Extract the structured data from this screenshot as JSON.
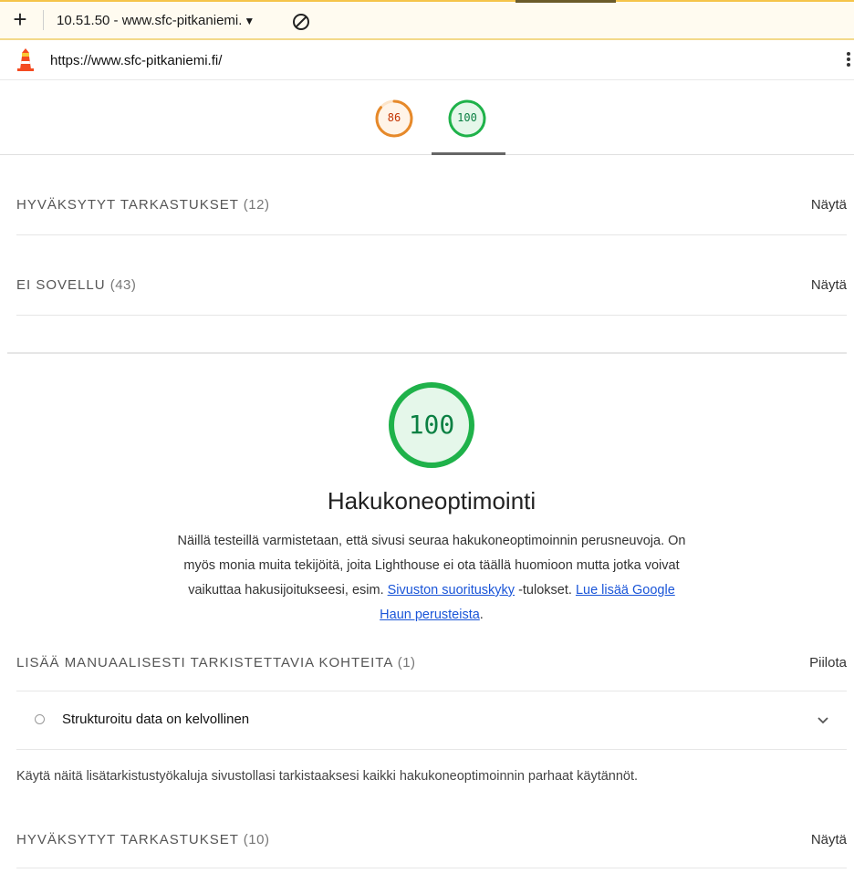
{
  "toolbar": {
    "plus_label": "+",
    "tab_title": "10.51.50 - www.sfc-pitkaniemi.",
    "dropdown_caret": "▼",
    "icons": {
      "new_tab": "plus-icon",
      "block": "block-icon"
    }
  },
  "urlbar": {
    "url": "https://www.sfc-pitkaniemi.fi/",
    "icons": {
      "logo": "lighthouse-logo-icon",
      "menu": "kebab-menu-icon"
    }
  },
  "score_tabs": [
    {
      "score": "86",
      "color": "#e6892a",
      "fill": "#fff4e8",
      "selected": false
    },
    {
      "score": "100",
      "color": "#1fb24a",
      "fill": "#e5f7ea",
      "selected": true
    }
  ],
  "groups_top": [
    {
      "title": "HYVÄKSYTYT TARKASTUKSET",
      "count": "(12)",
      "action": "Näytä"
    },
    {
      "title": "EI SOVELLU",
      "count": "(43)",
      "action": "Näytä"
    }
  ],
  "seo": {
    "score": "100",
    "score_color": "#1fb24a",
    "title": "Hakukoneoptimointi",
    "desc_text_1": "Näillä testeillä varmistetaan, että sivusi seuraa hakukoneoptimoinnin perusneuvoja. On myös monia muita tekijöitä, joita Lighthouse ei ota täällä huomioon mutta jotka voivat vaikuttaa hakusijoitukseesi, esim. ",
    "desc_link_1": "Sivuston suorituskyky",
    "desc_text_2": " -tulokset. ",
    "desc_link_2": "Lue lisää Google Haun perusteista",
    "desc_text_3": "."
  },
  "manual_group": {
    "title": "LISÄÄ MANUAALISESTI TARKISTETTAVIA KOHTEITA",
    "count": "(1)",
    "action": "Piilota",
    "items": [
      {
        "label": "Strukturoitu data on kelvollinen"
      }
    ],
    "description": "Käytä näitä lisätarkistustyökaluja sivustollasi tarkistaaksesi kaikki hakukoneoptimoinnin parhaat käytännöt."
  },
  "groups_bottom": [
    {
      "title": "HYVÄKSYTYT TARKASTUKSET",
      "count": "(10)",
      "action": "Näytä"
    }
  ],
  "colors": {
    "link": "#1a55d8",
    "toolbar_bg": "#fffbf0",
    "toolbar_border": "#f5c44a"
  }
}
